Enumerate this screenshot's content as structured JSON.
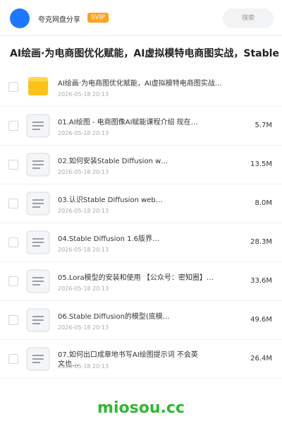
{
  "header": {
    "brand_name": "夸克网盘分享",
    "badge": "SVIP",
    "search_placeholder": "搜索",
    "colors": {
      "avatar": "#1e78ff",
      "badge": "#ffa31a"
    }
  },
  "folder": {
    "title": "AI绘画·为电商图优化赋能，AI虚拟模特电商图实战，Stable"
  },
  "files": [
    {
      "icon": "folder-icon",
      "name": "AI绘画·为电商图优化赋能，AI虚拟模特电商图实战…",
      "date": "2026-05-18 20:13",
      "size": ""
    },
    {
      "icon": "document-icon",
      "name": "01.AI绘图 - 电商图像AI赋能课程介绍 现在…",
      "date": "2026-05-18 20:13",
      "size": "5.7M"
    },
    {
      "icon": "document-icon",
      "name": "02.如何安装Stable Diffusion w…",
      "date": "2026-05-18 20:13",
      "size": "13.5M"
    },
    {
      "icon": "document-icon",
      "name": "03.认识Stable Diffusion web…",
      "date": "2026-05-18 20:13",
      "size": "8.0M"
    },
    {
      "icon": "document-icon",
      "name": "04.Stable Diffusion 1.6版界…",
      "date": "2026-05-18 20:13",
      "size": "28.3M"
    },
    {
      "icon": "document-icon",
      "name": "05.Lora模型的安装和使用 【公众号：密知圈】…",
      "date": "2026-05-18 20:13",
      "size": "33.6M"
    },
    {
      "icon": "document-icon",
      "name": "06.Stable Diffusion的模型(底模…",
      "date": "2026-05-18 20:13",
      "size": "49.6M"
    },
    {
      "icon": "document-icon",
      "name": "07.如何出口成章地书写AI绘图提示词 不会英文也…",
      "date": "2026-05-18 20:13",
      "size": "26.4M"
    }
  ],
  "watermark": "miosou.cc"
}
